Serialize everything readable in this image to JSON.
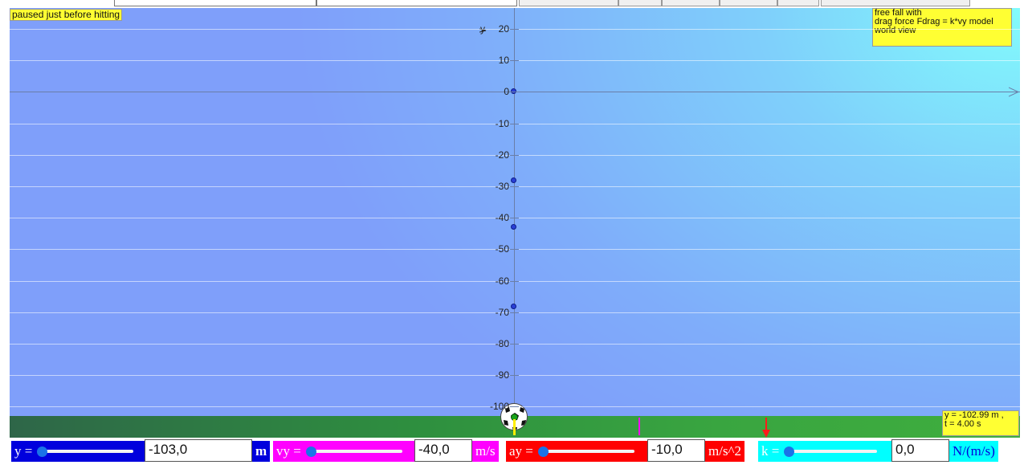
{
  "status": {
    "paused_label": "paused just before hitting"
  },
  "info_box": {
    "line1": "free fall with",
    "line2": "drag force Fdrag = k*vy model",
    "line3": "world view"
  },
  "readout": {
    "line1": "y = -102.99 m ,",
    "line2": "t = 4.00 s"
  },
  "axis": {
    "y_label": "y",
    "ticks": [
      "20",
      "10",
      "0",
      "-10",
      "-20",
      "-30",
      "-40",
      "-50",
      "-60",
      "-70",
      "-80",
      "-90",
      "-100"
    ]
  },
  "controls": {
    "y": {
      "symbol": "y =",
      "value": "-103,0",
      "unit": "m",
      "color": "#0000dd",
      "slider_fraction": 0.0
    },
    "vy": {
      "symbol": "vy =",
      "value": "-40,0",
      "unit": "m/s",
      "color": "#ff00ff",
      "slider_fraction": 0.0
    },
    "ay": {
      "symbol": "ay =",
      "value": "-10,0",
      "unit": "m/s^2",
      "color": "#ff0000",
      "slider_fraction": 0.0
    },
    "k": {
      "symbol": "k =",
      "value": "0,0",
      "unit": "N/(m/s)",
      "color": "#00ffff",
      "slider_fraction": 0.0
    }
  },
  "colors": {
    "ground": "#2e8f3f",
    "note_bg": "#ffff33",
    "sky_top_right": "#82fcfc",
    "sky_left": "#7f9ffa"
  }
}
